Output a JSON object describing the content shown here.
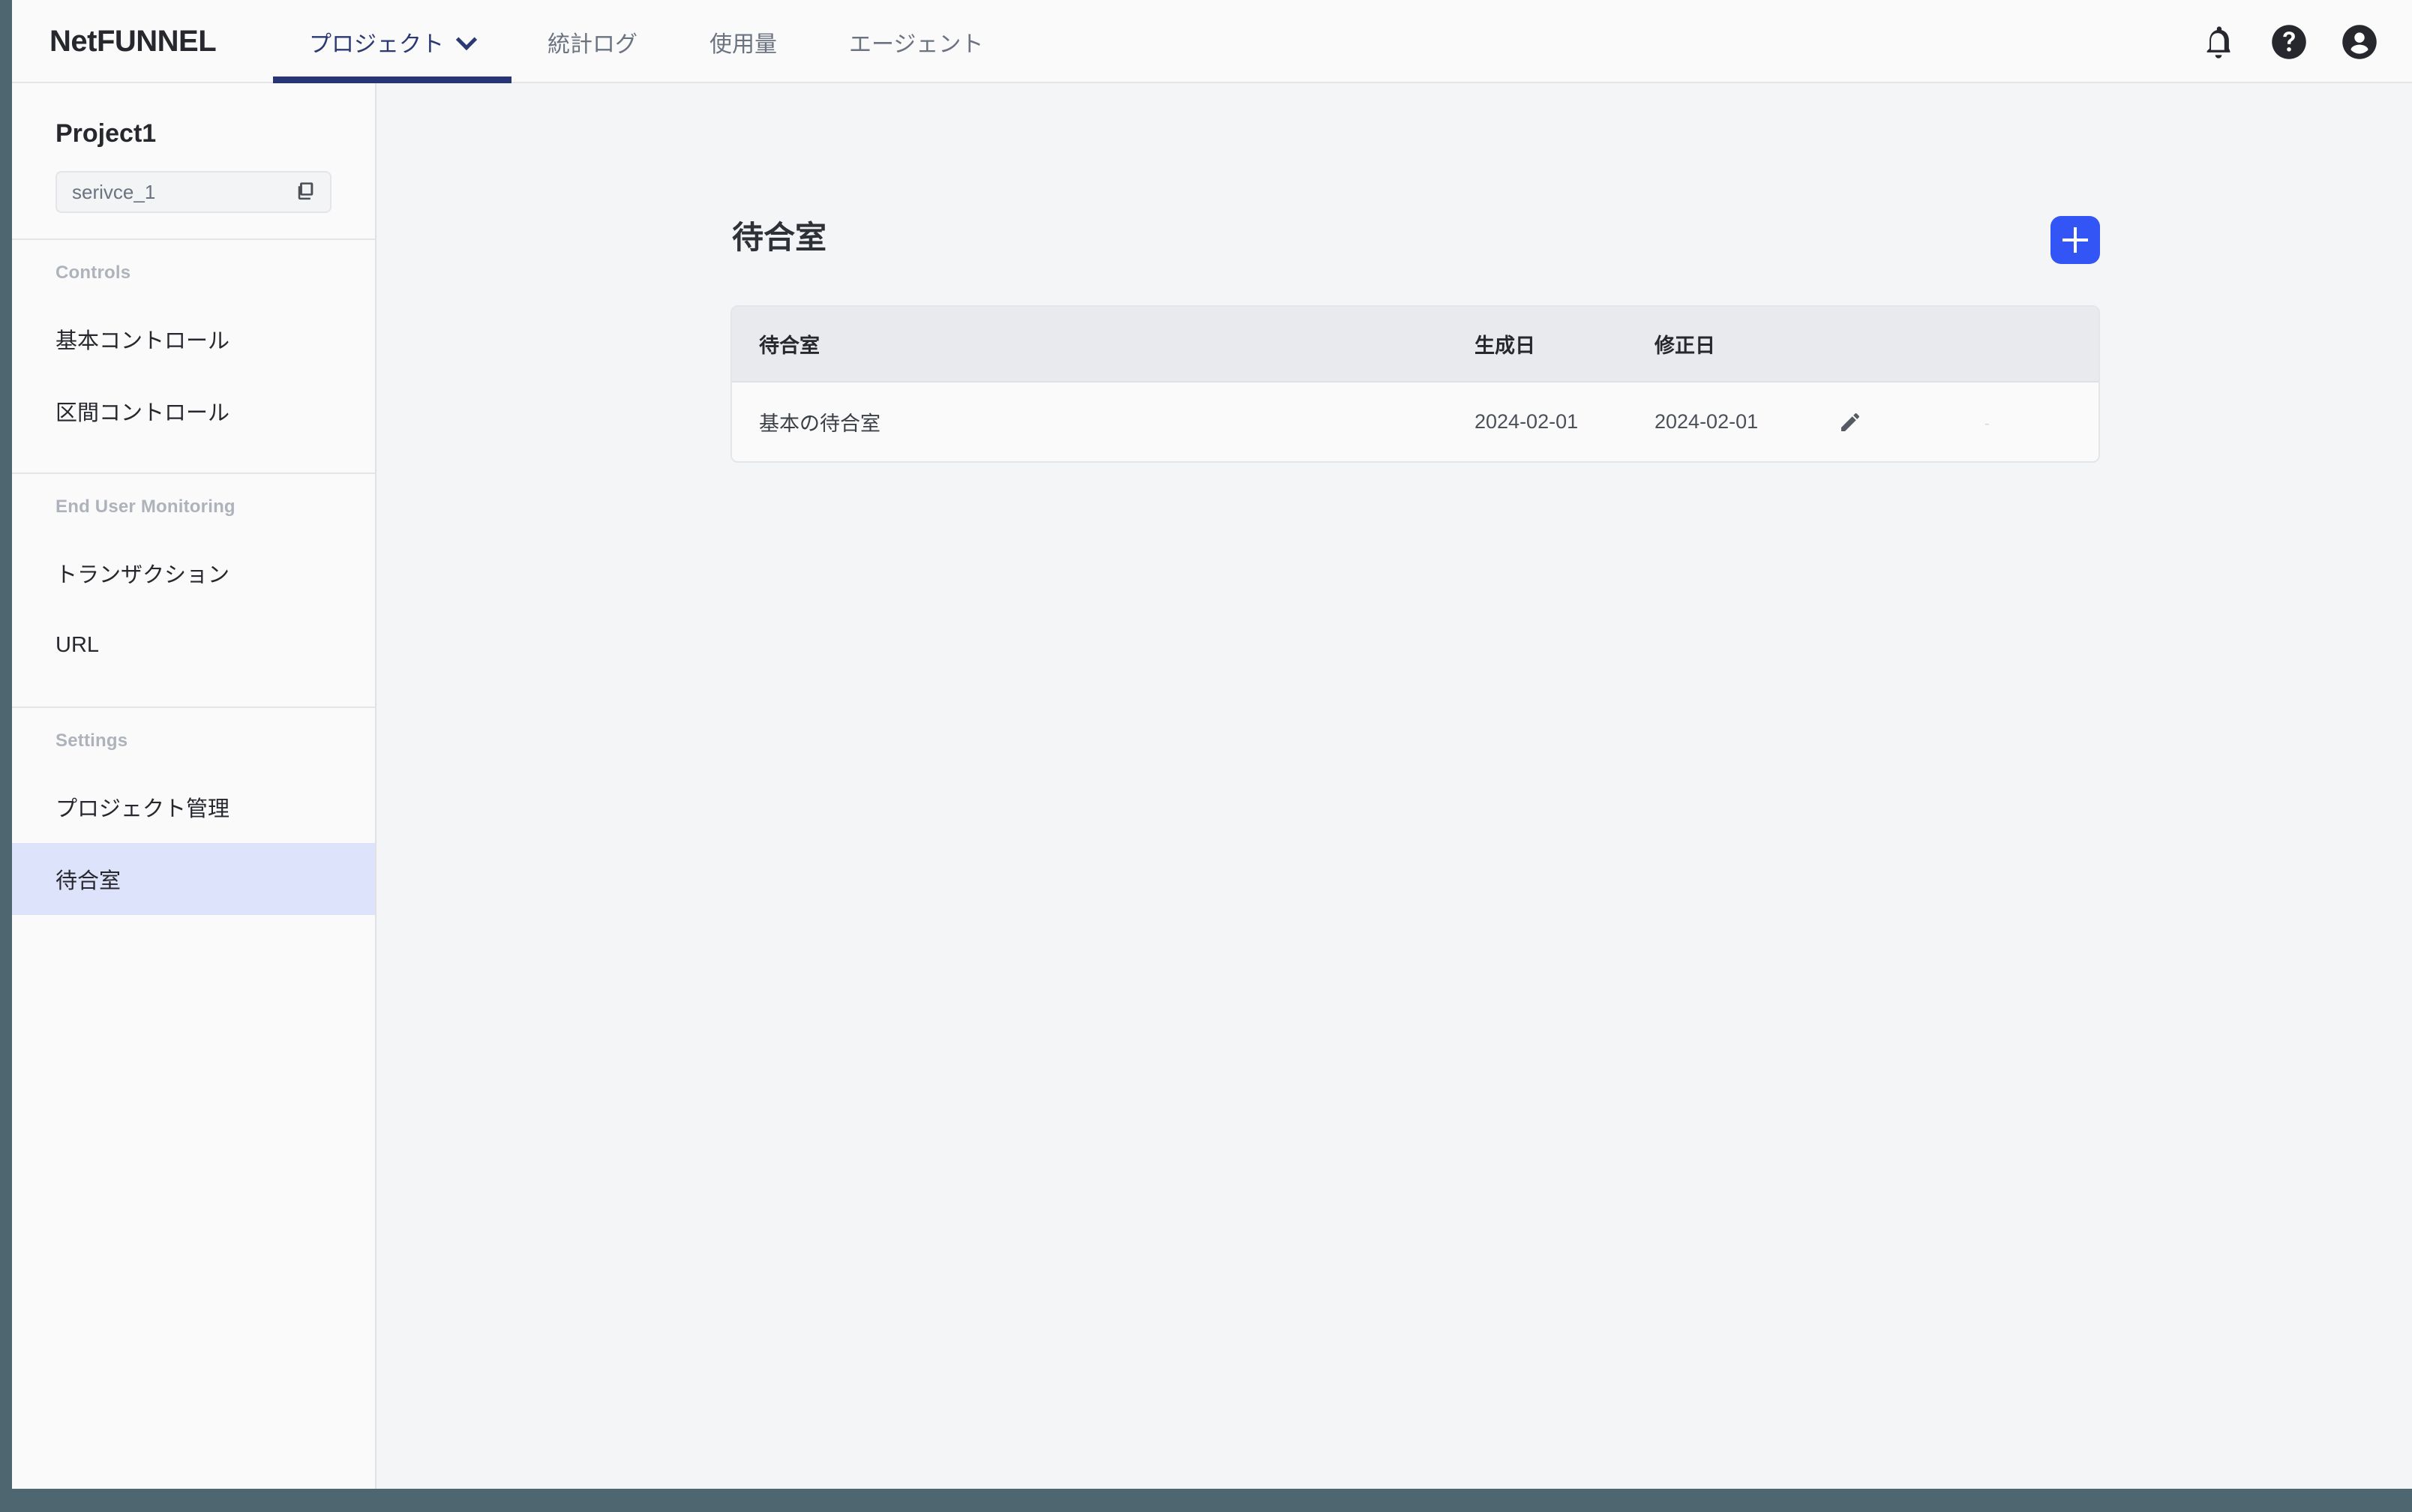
{
  "header": {
    "brand": "NetFUNNEL",
    "tabs": [
      {
        "label": "プロジェクト",
        "active": true,
        "has_chevron": true,
        "icon": "chevron-down-icon"
      },
      {
        "label": "統計ログ",
        "active": false,
        "has_chevron": false
      },
      {
        "label": "使用量",
        "active": false,
        "has_chevron": false
      },
      {
        "label": "エージェント",
        "active": false,
        "has_chevron": false
      }
    ],
    "icons": [
      {
        "name": "notification-bell-icon"
      },
      {
        "name": "help-circle-icon"
      },
      {
        "name": "account-circle-icon"
      }
    ],
    "active_tab_underline_color": "#283574"
  },
  "sidebar": {
    "project_title": "Project1",
    "service_field": {
      "value": "serivce_1",
      "copy_icon": "copy-icon"
    },
    "sections": [
      {
        "label": "Controls",
        "items": [
          {
            "label": "基本コントロール",
            "active": false
          },
          {
            "label": "区間コントロール",
            "active": false
          }
        ]
      },
      {
        "label": "End User Monitoring",
        "items": [
          {
            "label": "トランザクション",
            "active": false
          },
          {
            "label": "URL",
            "active": false
          }
        ]
      },
      {
        "label": "Settings",
        "items": [
          {
            "label": "プロジェクト管理",
            "active": false
          },
          {
            "label": "待合室",
            "active": true
          }
        ]
      }
    ],
    "active_item_background": "#dde3fb"
  },
  "main": {
    "page_title": "待合室",
    "add_button": {
      "label": "+",
      "icon": "plus-icon",
      "color": "#3355f5"
    },
    "table": {
      "columns": [
        "待合室",
        "生成日",
        "修正日",
        "",
        ""
      ],
      "rows": [
        {
          "name": "基本の待合室",
          "created": "2024-02-01",
          "modified": "2024-02-01",
          "edit_icon": "pencil-edit-icon",
          "delete_placeholder": "-"
        }
      ],
      "header_background": "#e8eaee"
    }
  }
}
